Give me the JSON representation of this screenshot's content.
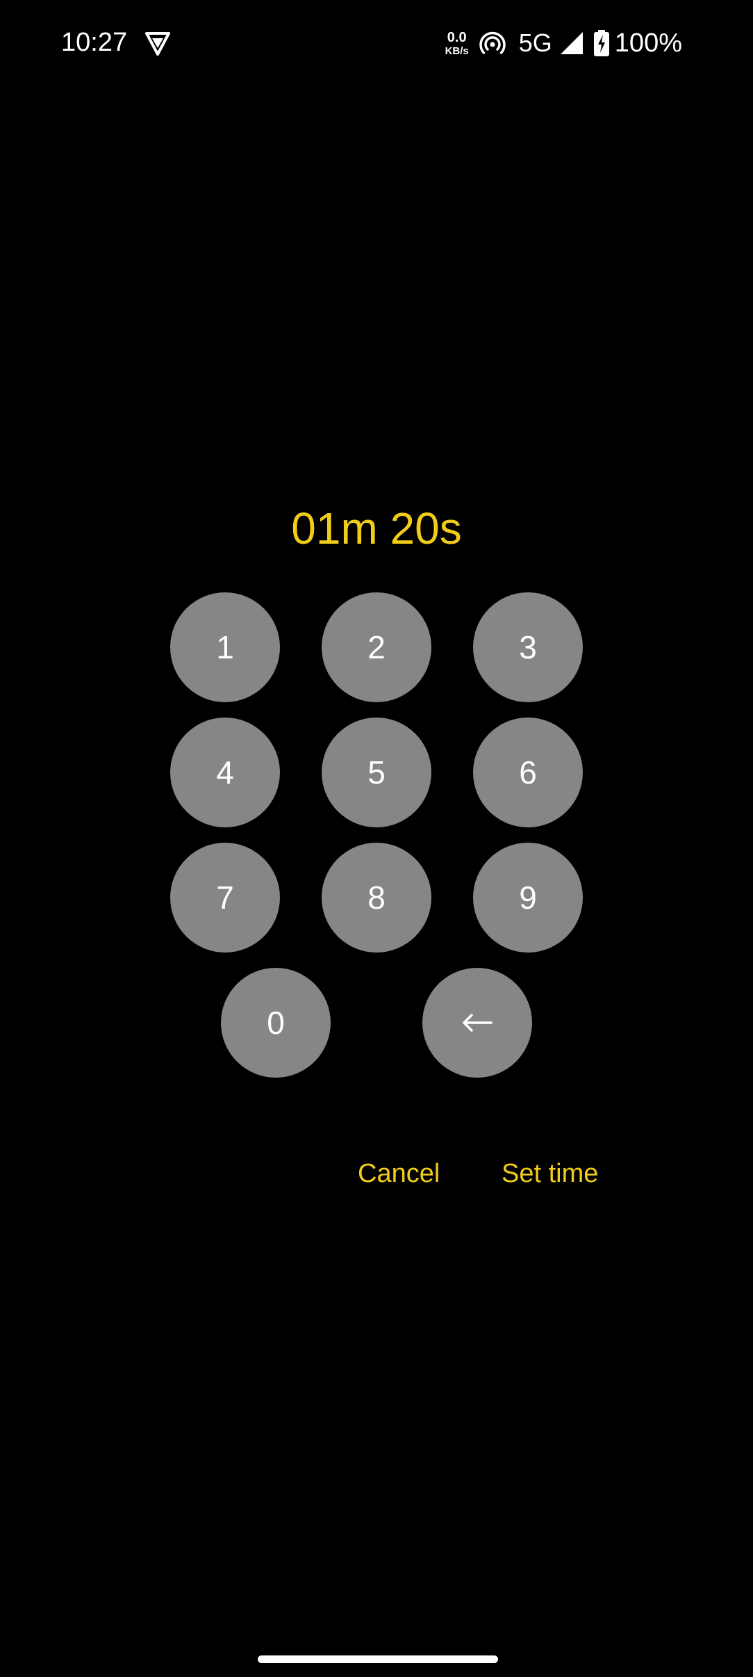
{
  "status_bar": {
    "time": "10:27",
    "net_speed_value": "0.0",
    "net_speed_unit": "KB/s",
    "network_type": "5G",
    "battery_percent": "100%",
    "icons": [
      "shield-icon",
      "hotspot-icon",
      "signal-icon",
      "battery-charging-icon"
    ]
  },
  "timer": {
    "display": "01m 20s"
  },
  "keypad": {
    "keys": [
      "1",
      "2",
      "3",
      "4",
      "5",
      "6",
      "7",
      "8",
      "9",
      "0"
    ],
    "backspace_icon": "backspace-arrow-icon"
  },
  "actions": {
    "cancel_label": "Cancel",
    "set_label": "Set time"
  },
  "colors": {
    "background": "#000000",
    "accent": "#f2cd18",
    "key_fill": "#868686",
    "key_text": "#ffffff"
  }
}
